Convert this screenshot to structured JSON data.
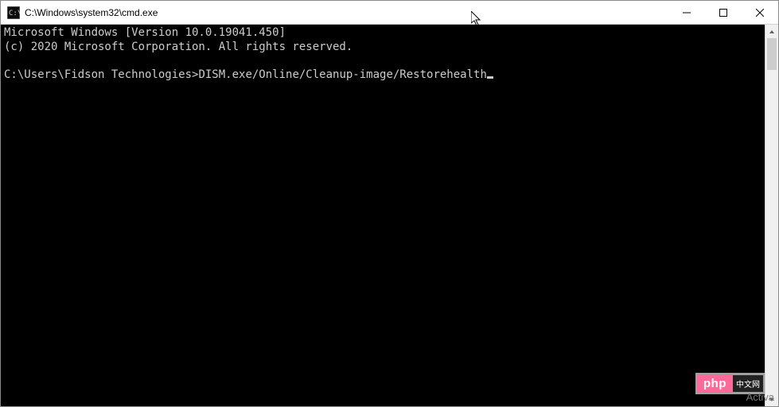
{
  "window": {
    "title": "C:\\Windows\\system32\\cmd.exe"
  },
  "console": {
    "line1": "Microsoft Windows [Version 10.0.19041.450]",
    "line2": "(c) 2020 Microsoft Corporation. All rights reserved.",
    "blank": "",
    "prompt": "C:\\Users\\Fidson Technologies>",
    "command": "DISM.exe/Online/Cleanup-image/Restorehealth"
  },
  "watermark": {
    "text": "Activa"
  },
  "badge": {
    "php": "php",
    "cn": "中文网"
  }
}
